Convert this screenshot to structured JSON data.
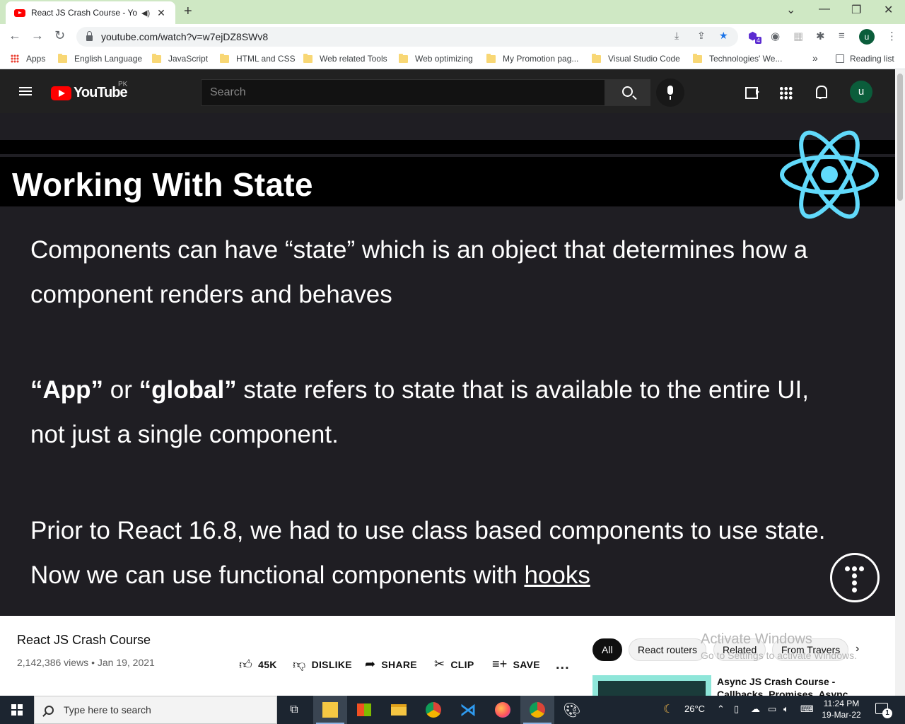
{
  "browser": {
    "tab_title": "React JS Crash Course - YouTube",
    "tab_audio_icon": "speaker-icon",
    "tab_close": "✕",
    "new_tab": "+",
    "url": "youtube.com/watch?v=w7ejDZ8SWv8",
    "extension_badge": "4",
    "profile_initial": "u",
    "bookmarks": [
      "Apps",
      "English Language",
      "JavaScript",
      "HTML and CSS",
      "Web related Tools",
      "Web optimizing",
      "My Promotion pag...",
      "Visual Studio Code",
      "Technologies' We..."
    ],
    "bookmarks_more": "»",
    "reading_list": "Reading list"
  },
  "youtube": {
    "logo_text": "YouTube",
    "region": "PK",
    "search_placeholder": "Search",
    "avatar_initial": "u"
  },
  "slide": {
    "title": "Working With State",
    "p1_line1": "Components can have “state” which is an object that determines how a",
    "p1_line2": "component renders and behaves",
    "p2_app": "“App”",
    "p2_or": " or ",
    "p2_global": "“global”",
    "p2_rest": " state refers to state that is available to the entire UI,",
    "p2_line2": "not just a single component.",
    "p3_line1": "Prior to React 16.8, we had to use class based components to use state.",
    "p3_line2_prefix": "Now we can use functional components with ",
    "p3_hooks": "hooks"
  },
  "video": {
    "title": "React JS Crash Course",
    "meta": "2,142,386 views • Jan 19, 2021",
    "like_count": "45K",
    "dislike": "DISLIKE",
    "share": "SHARE",
    "clip": "CLIP",
    "save": "SAVE",
    "more": "..."
  },
  "chips": [
    "All",
    "React routers",
    "Related",
    "From Travers"
  ],
  "chip_next": "›",
  "related": {
    "title": "Async JS Crash Course - Callbacks, Promises, Async"
  },
  "watermark": {
    "line1": "Activate Windows",
    "line2": "Go to Settings to activate Windows."
  },
  "taskbar": {
    "search_placeholder": "Type here to search",
    "temperature": "26°C",
    "time": "11:24 PM",
    "date": "19-Mar-22",
    "notification_count": "1"
  },
  "colors": {
    "tabbar_bg": "#cfe8c4",
    "yt_header_bg": "#212121",
    "video_bg": "#1f1e23",
    "react_blue": "#61dafb",
    "yt_red": "#ff0000",
    "taskbar_bg": "#1c2530"
  }
}
